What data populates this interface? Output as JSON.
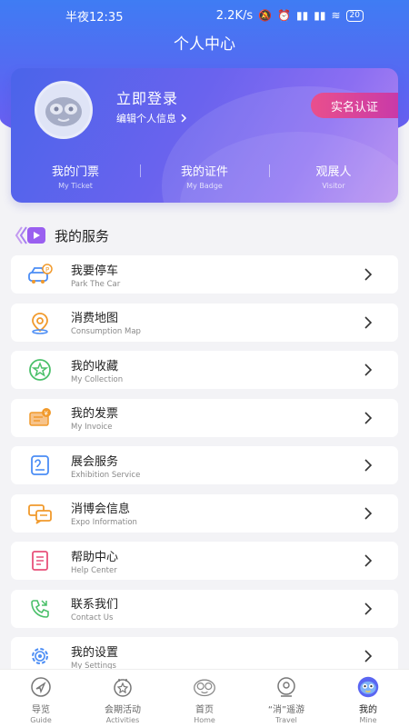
{
  "status_bar": {
    "time": "半夜12:35",
    "network_speed": "2.2K/s",
    "battery": "20"
  },
  "header": {
    "title": "个人中心"
  },
  "profile": {
    "login_text": "立即登录",
    "edit_info": "编辑个人信息",
    "verify_label": "实名认证",
    "tabs": [
      {
        "label": "我的门票",
        "sub": "My Ticket"
      },
      {
        "label": "我的证件",
        "sub": "My Badge"
      },
      {
        "label": "观展人",
        "sub": "Visitor"
      }
    ]
  },
  "services": {
    "title": "我的服务",
    "items": [
      {
        "label": "我要停车",
        "sub": "Park The Car",
        "icon": "car-icon"
      },
      {
        "label": "消费地图",
        "sub": "Consumption Map",
        "icon": "map-pin-icon"
      },
      {
        "label": "我的收藏",
        "sub": "My Collection",
        "icon": "star-icon"
      },
      {
        "label": "我的发票",
        "sub": "My Invoice",
        "icon": "invoice-icon"
      },
      {
        "label": "展会服务",
        "sub": "Exhibition Service",
        "icon": "exhibition-icon"
      },
      {
        "label": "消博会信息",
        "sub": "Expo Information",
        "icon": "chat-icon"
      },
      {
        "label": "帮助中心",
        "sub": "Help Center",
        "icon": "help-icon"
      },
      {
        "label": "联系我们",
        "sub": "Contact Us",
        "icon": "phone-icon"
      },
      {
        "label": "我的设置",
        "sub": "My Settings",
        "icon": "gear-icon"
      }
    ]
  },
  "tab_bar": {
    "items": [
      {
        "label": "导览",
        "sub": "Guide",
        "icon": "compass-icon"
      },
      {
        "label": "会期活动",
        "sub": "Activities",
        "icon": "activities-icon"
      },
      {
        "label": "首页",
        "sub": "Home",
        "icon": "home-icon"
      },
      {
        "label": "“消”遥游",
        "sub": "Travel",
        "icon": "travel-icon"
      },
      {
        "label": "我的",
        "sub": "Mine",
        "icon": "mine-icon"
      }
    ]
  },
  "colors": {
    "accent": "#5a66f2",
    "verify": "#e94f8c",
    "icon_blue": "#4b8df5",
    "icon_orange": "#f19a2c",
    "icon_green": "#4bc06a",
    "icon_pink": "#e8507a"
  }
}
